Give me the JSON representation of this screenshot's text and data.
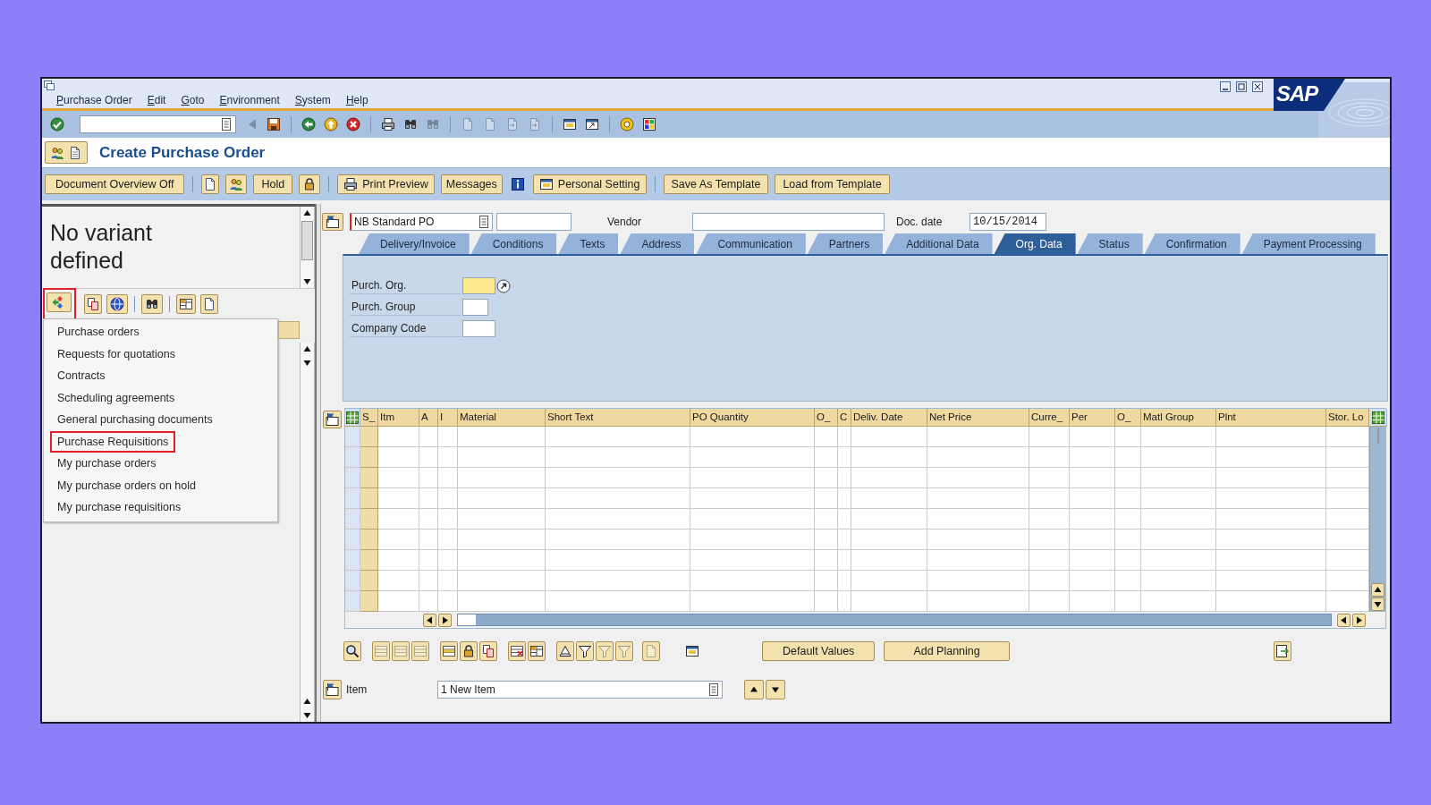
{
  "window": {
    "menu": [
      "Purchase Order",
      "Edit",
      "Goto",
      "Environment",
      "System",
      "Help"
    ],
    "logo": "SAP"
  },
  "title": "Create Purchase Order",
  "app_toolbar": {
    "buttons": [
      "Document Overview Off",
      "Hold",
      "Print Preview",
      "Messages",
      "Personal Setting",
      "Save As Template",
      "Load from Template"
    ]
  },
  "variant_panel": {
    "text": "No variant defined"
  },
  "selection_toolbar": {
    "highlighted": true
  },
  "selection_menu": [
    {
      "label": "Purchase orders",
      "highlighted": false
    },
    {
      "label": "Requests for quotations",
      "highlighted": false
    },
    {
      "label": "Contracts",
      "highlighted": false
    },
    {
      "label": "Scheduling agreements",
      "highlighted": false
    },
    {
      "label": "General purchasing documents",
      "highlighted": false
    },
    {
      "label": "Purchase Requisitions",
      "highlighted": true
    },
    {
      "label": "My purchase orders",
      "highlighted": false
    },
    {
      "label": "My purchase orders on hold",
      "highlighted": false
    },
    {
      "label": "My purchase requisitions",
      "highlighted": false
    }
  ],
  "header": {
    "document_type": "NB Standard PO",
    "vendor_label": "Vendor",
    "doc_date_label": "Doc. date",
    "doc_date": "10/15/2014"
  },
  "tabs": [
    {
      "label": "Delivery/Invoice",
      "selected": false
    },
    {
      "label": "Conditions",
      "selected": false
    },
    {
      "label": "Texts",
      "selected": false
    },
    {
      "label": "Address",
      "selected": false
    },
    {
      "label": "Communication",
      "selected": false
    },
    {
      "label": "Partners",
      "selected": false
    },
    {
      "label": "Additional Data",
      "selected": false
    },
    {
      "label": "Org. Data",
      "selected": true
    },
    {
      "label": "Status",
      "selected": false
    },
    {
      "label": "Confirmation",
      "selected": false
    },
    {
      "label": "Payment Processing",
      "selected": false
    }
  ],
  "org_data": [
    {
      "label": "Purch. Org.",
      "focused": true
    },
    {
      "label": "Purch. Group",
      "focused": false
    },
    {
      "label": "Company Code",
      "focused": false
    }
  ],
  "items_table": {
    "columns": [
      "S_",
      "Itm",
      "A",
      "I",
      "Material",
      "Short Text",
      "PO Quantity",
      "O_",
      "C",
      "Deliv. Date",
      "Net Price",
      "Curre_",
      "Per",
      "O_",
      "Matl Group",
      "Plnt",
      "Stor. Lo"
    ]
  },
  "table_buttons": [
    "Default Values",
    "Add Planning"
  ],
  "item_selector": {
    "label": "Item",
    "value": "1 New Item"
  }
}
